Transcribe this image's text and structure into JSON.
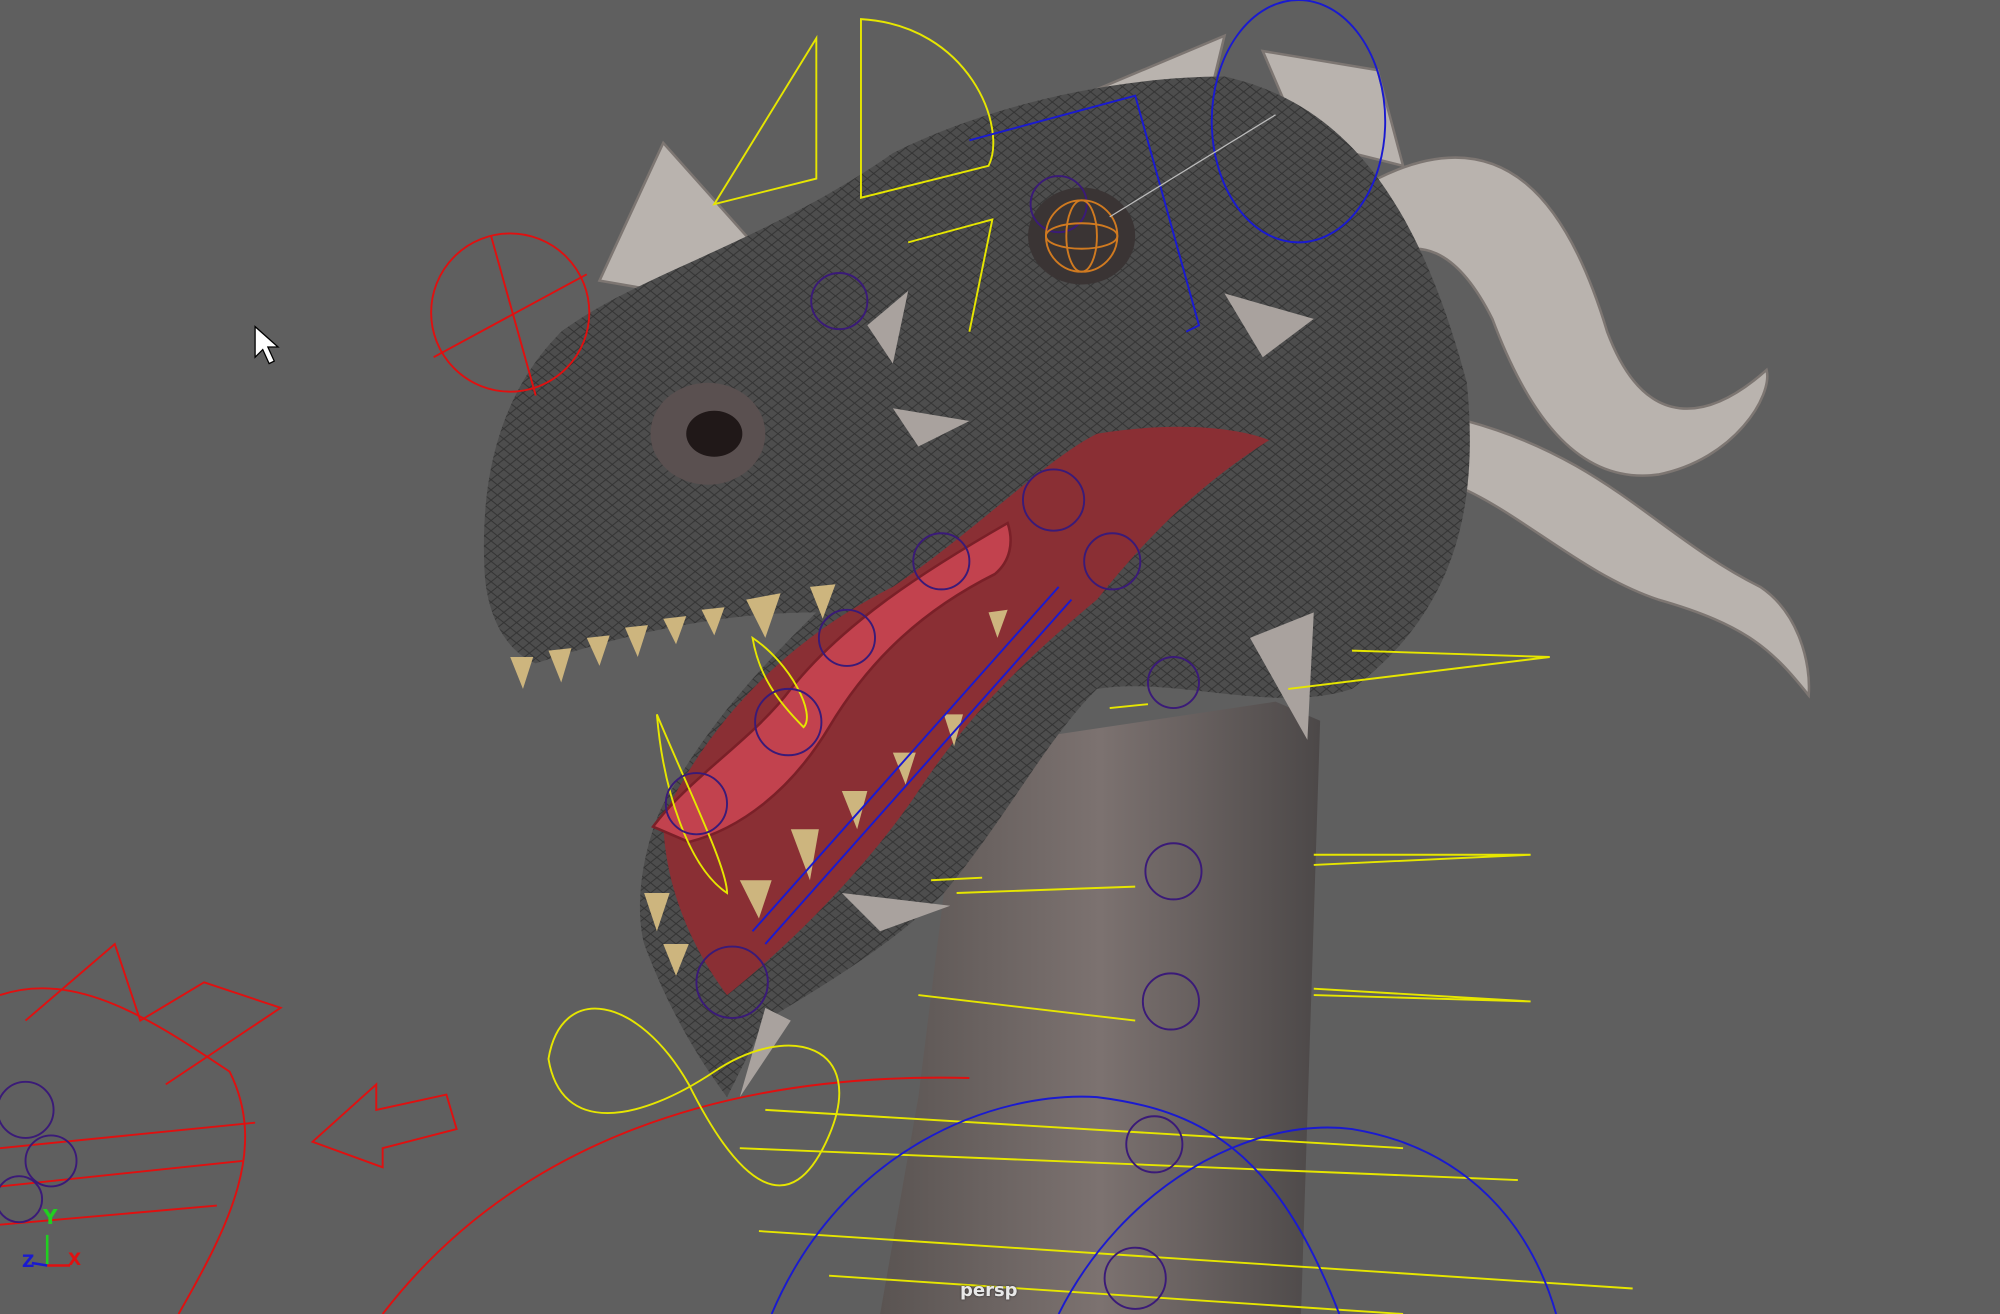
{
  "viewport": {
    "camera_label": "persp",
    "axis_labels": {
      "x": "X",
      "y": "Y",
      "z": "Z"
    }
  },
  "colors": {
    "background": "#5f5f5f",
    "skin": "#4a4a4a",
    "neck": "#6e6664",
    "mouth": "#8a2f34",
    "horn": "#b9b3ae",
    "control_yellow": "#e6e600",
    "control_blue": "#1a1ad0",
    "control_red": "#e01010",
    "joint_purple": "#3a1a78",
    "eye_orange": "#d07a20"
  }
}
